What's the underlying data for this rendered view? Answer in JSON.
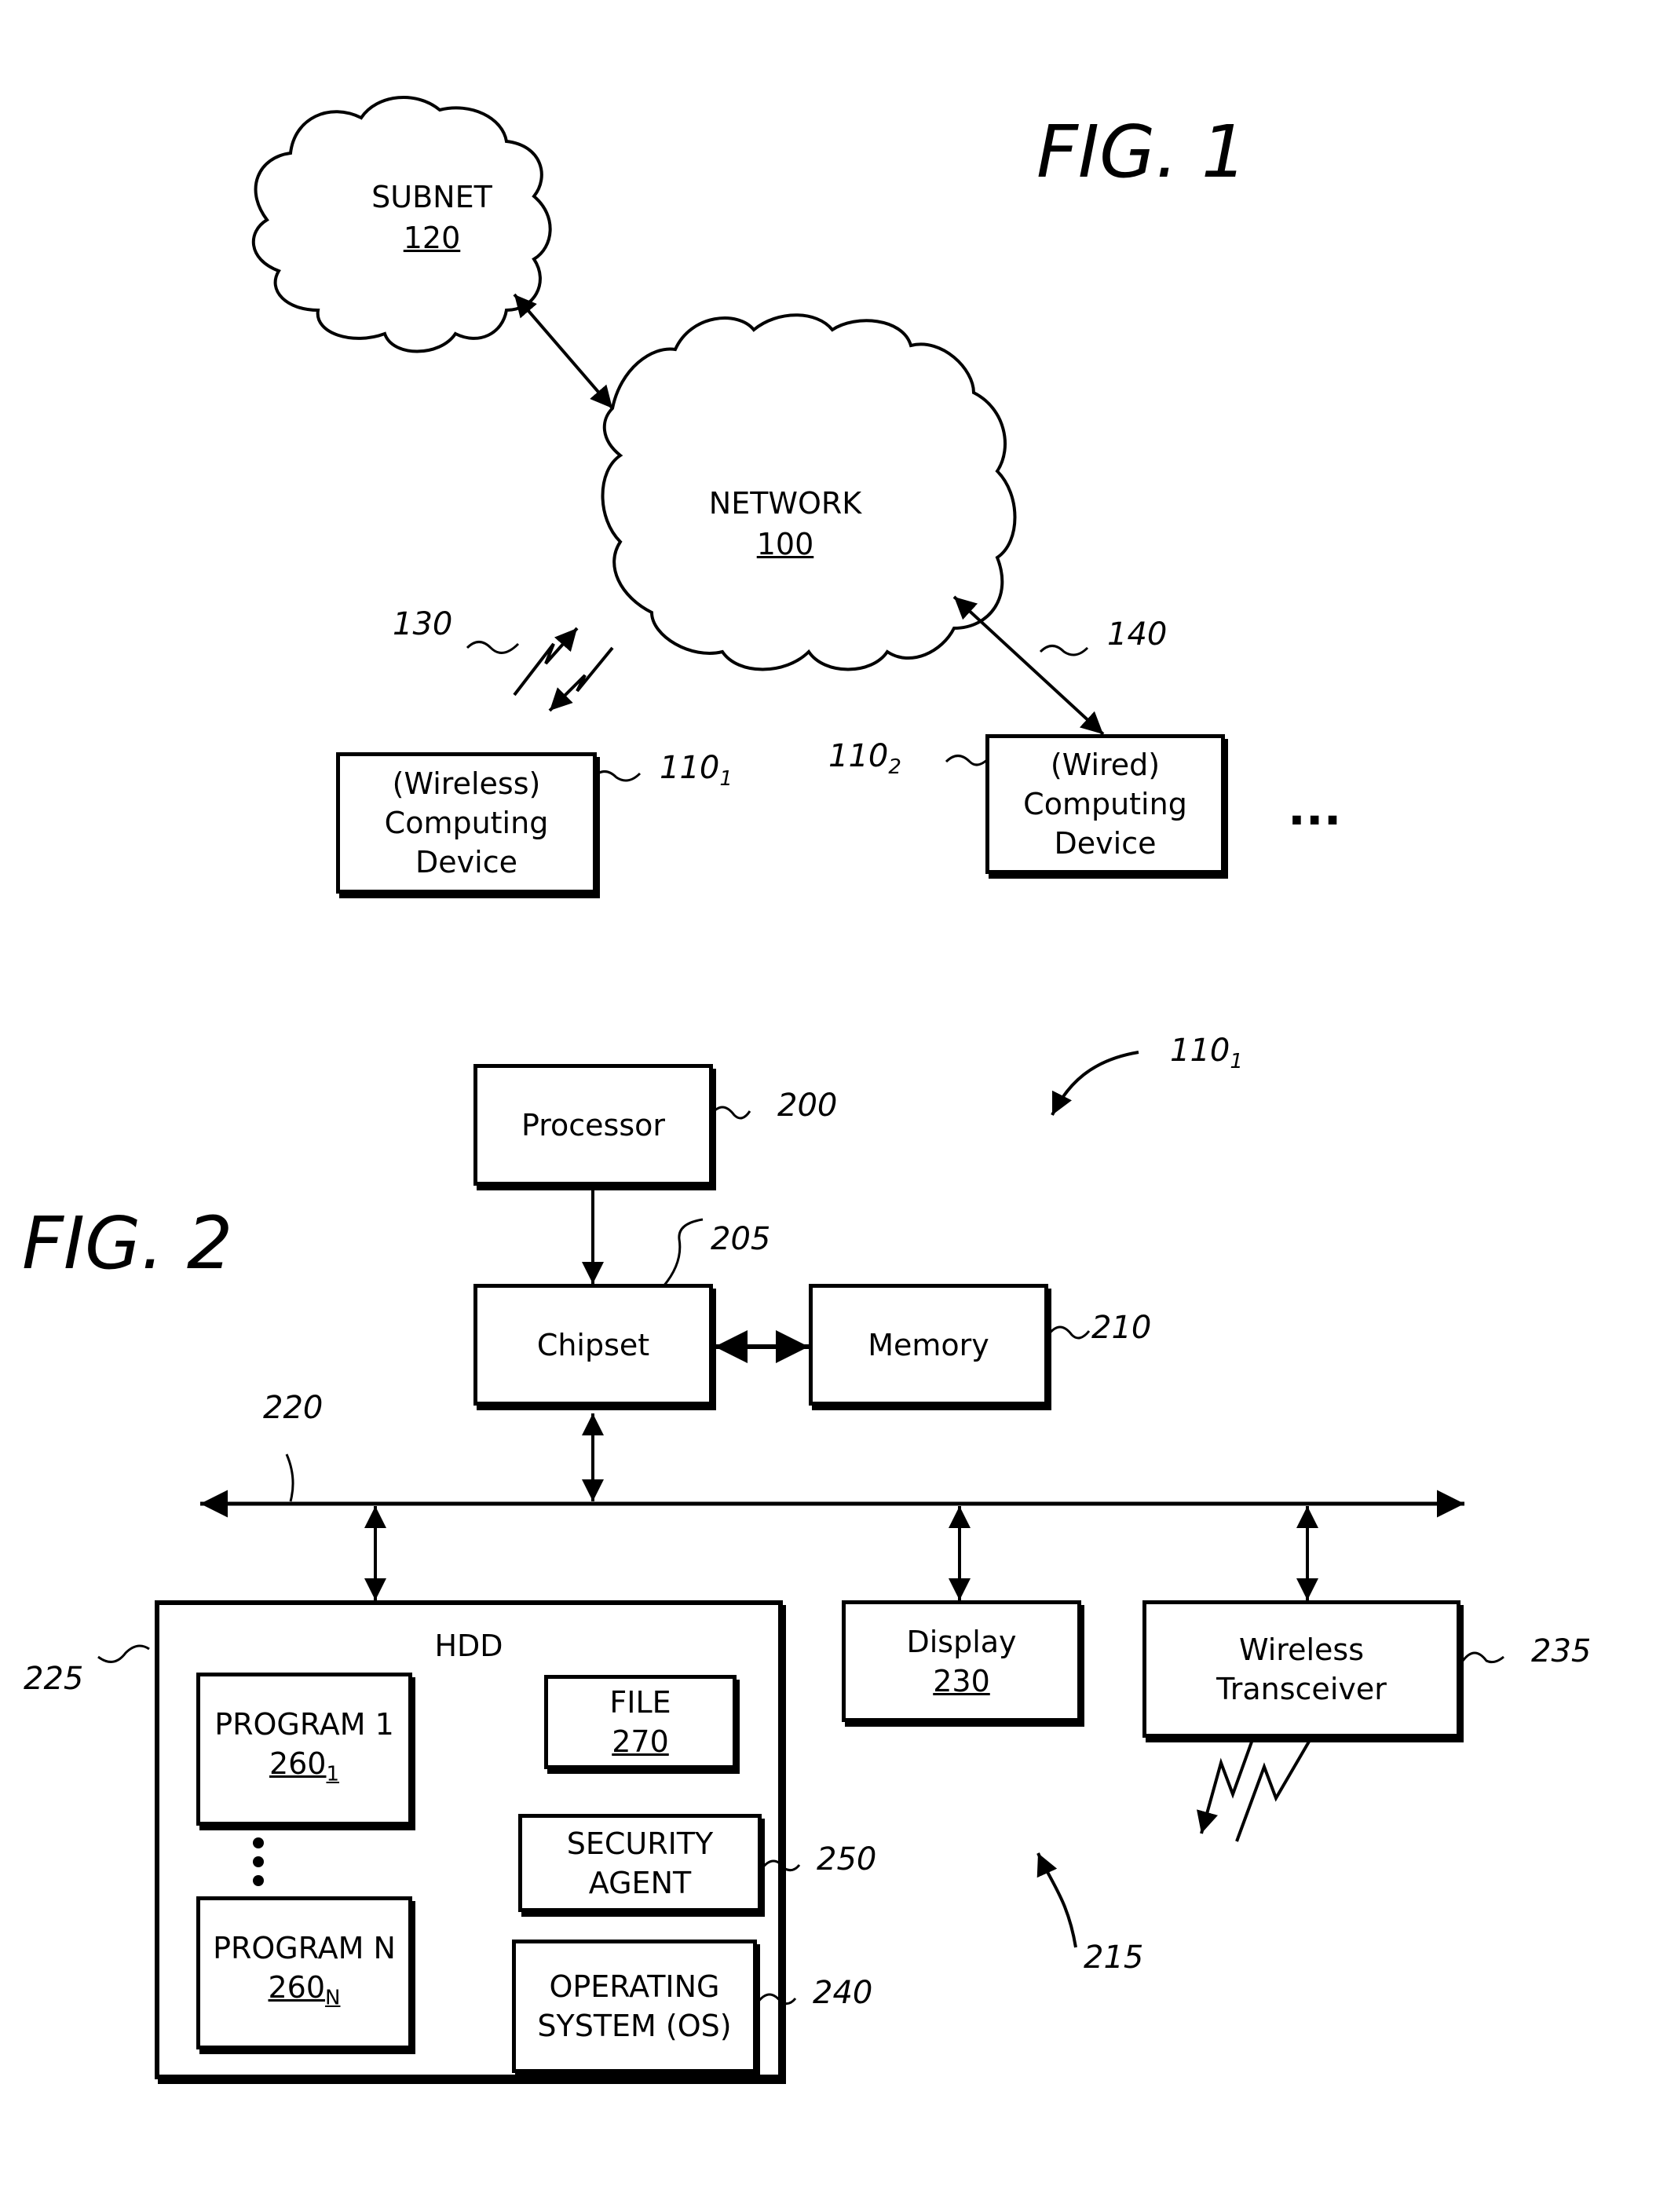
{
  "fig1": {
    "title": "FIG. 1",
    "subnet": {
      "label": "SUBNET",
      "ref": "120"
    },
    "network": {
      "label": "NETWORK",
      "ref": "100"
    },
    "wireless_device": {
      "line1": "(Wireless)",
      "line2": "Computing",
      "line3": "Device",
      "ref": "110",
      "ref_sub": "1"
    },
    "wired_device": {
      "line1": "(Wired)",
      "line2": "Computing",
      "line3": "Device",
      "ref": "110",
      "ref_sub": "2"
    },
    "wireless_link_ref": "130",
    "wired_link_ref": "140",
    "ellipsis": "..."
  },
  "fig2": {
    "title": "FIG. 2",
    "device_ref": "110",
    "device_ref_sub": "1",
    "processor": {
      "label": "Processor",
      "ref": "200"
    },
    "chipset": {
      "label": "Chipset",
      "ref": "205"
    },
    "memory": {
      "label": "Memory",
      "ref": "210"
    },
    "bus_ref": "220",
    "hdd": {
      "label": "HDD",
      "ref": "225",
      "program1": {
        "label": "PROGRAM 1",
        "ref": "260",
        "ref_sub": "1"
      },
      "programN": {
        "label": "PROGRAM N",
        "ref": "260",
        "ref_sub": "N"
      },
      "file": {
        "label": "FILE",
        "ref": "270"
      },
      "security_agent": {
        "line1": "SECURITY",
        "line2": "AGENT",
        "ref": "250"
      },
      "os": {
        "line1": "OPERATING",
        "line2": "SYSTEM (OS)",
        "ref": "240"
      }
    },
    "display": {
      "label": "Display",
      "ref": "230"
    },
    "transceiver": {
      "line1": "Wireless",
      "line2": "Transceiver",
      "ref": "235"
    },
    "logic_ref": "215"
  }
}
